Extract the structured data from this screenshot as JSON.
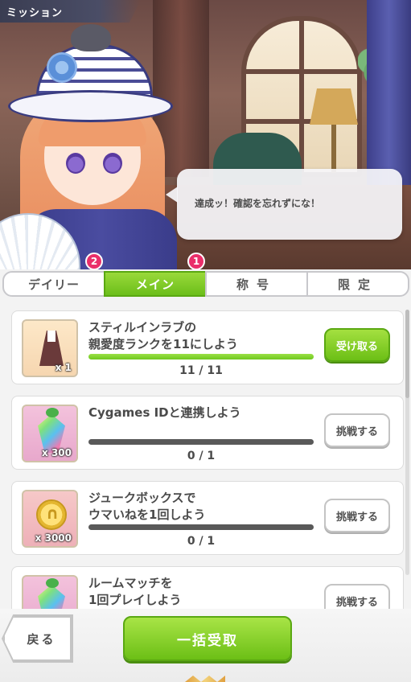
{
  "header": {
    "title": "ミッション"
  },
  "speech": {
    "text": "達成ッ！確認を忘れずにな！"
  },
  "tabs": [
    {
      "label": "デイリー",
      "badge": "2",
      "active": false
    },
    {
      "label": "メイン",
      "badge": "1",
      "active": true
    },
    {
      "label": "称号",
      "badge": null,
      "active": false
    },
    {
      "label": "限定",
      "badge": null,
      "active": false
    }
  ],
  "missions": [
    {
      "title_line1": "スティルインラブの",
      "title_line2": "親愛度ランクを11にしよう",
      "item_icon": "dress-icon",
      "quantity": "x 1",
      "progress_text": "11 / 11",
      "progress_fraction": 1.0,
      "button_label": "受け取る",
      "button_kind": "receive"
    },
    {
      "title_line1": "Cygames IDと連携しよう",
      "title_line2": "",
      "item_icon": "crystal-icon",
      "quantity": "x 300",
      "progress_text": "0 / 1",
      "progress_fraction": 0.0,
      "button_label": "挑戦する",
      "button_kind": "challenge"
    },
    {
      "title_line1": "ジュークボックスで",
      "title_line2": "ウマいねを1回しよう",
      "item_icon": "coin-icon",
      "quantity": "x 3000",
      "progress_text": "0 / 1",
      "progress_fraction": 0.0,
      "button_label": "挑戦する",
      "button_kind": "challenge"
    },
    {
      "title_line1": "ルームマッチを",
      "title_line2": "1回プレイしよう",
      "item_icon": "crystal-icon",
      "quantity": "",
      "progress_text": "",
      "progress_fraction": 0.0,
      "button_label": "挑戦する",
      "button_kind": "challenge"
    }
  ],
  "footer": {
    "back_label": "戻る",
    "bulk_receive_label": "一括受取"
  },
  "colors": {
    "accent_green": "#6cbf16",
    "badge_pink": "#ea2f6a",
    "text_gray": "#4a4a4a"
  }
}
